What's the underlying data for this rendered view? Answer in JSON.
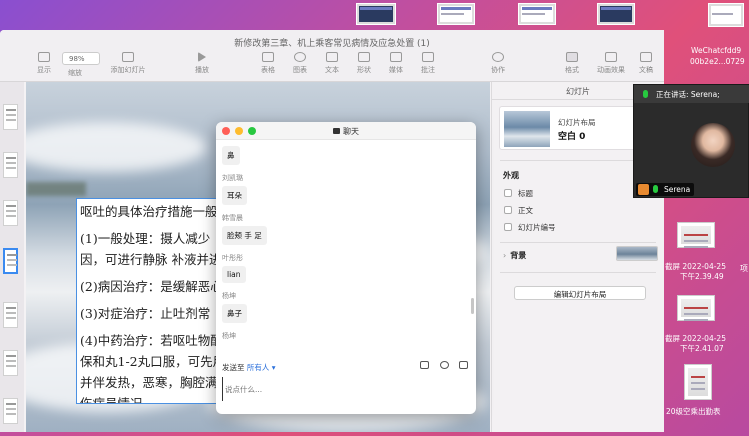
{
  "keynote": {
    "window_title": "新修改第三章、机上乘客常见病情及应急处置 (1)",
    "toolbar": {
      "view_label": "显示",
      "zoom_value": "98%",
      "zoom_label": "缩放",
      "add_slide_label": "添加幻灯片",
      "play_label": "播放",
      "table_label": "表格",
      "chart_label": "图表",
      "text_label": "文本",
      "shape_label": "形状",
      "media_label": "媒体",
      "comment_label": "批注",
      "collaborate_label": "协作",
      "format_label": "格式",
      "animate_label": "动画效果",
      "document_label": "文稿"
    },
    "slide_text": [
      "呕吐的具体治疗措施一般",
      "(1)一般处理：摄人减少",
      "因，可进行静脉 补液并进",
      "(2)病因治疗：是缓解恶心",
      "(3)对症治疗：止吐剂常",
      "(4)中药治疗：若呕吐物酸",
      "保和丸1-2丸口服，可先用",
      "并伴发热，恶寒，胸腔满",
      "伤病员情况。"
    ],
    "inspector": {
      "header": "幻灯片",
      "layout_label": "幻灯片布局",
      "layout_value": "空白 0",
      "appearance_title": "外观",
      "checkbox_title": "标题",
      "checkbox_body": "正文",
      "checkbox_slide_number": "幻灯片编号",
      "background_label": "背景",
      "edit_layout_button": "编辑幻灯片布局"
    }
  },
  "chat": {
    "title": "聊天",
    "messages": [
      {
        "sender": "",
        "text": "鼻"
      },
      {
        "sender": "刘凯璐",
        "text": "耳朵"
      },
      {
        "sender": "韩雪晨",
        "text": "脸颊 手 足"
      },
      {
        "sender": "叶彤彤",
        "text": "lian"
      },
      {
        "sender": "杨坤",
        "text": "鼻子"
      },
      {
        "sender": "杨坤",
        "text": ""
      }
    ],
    "send_to_label": "发送至",
    "send_to_value": "所有人",
    "input_placeholder": "说点什么..."
  },
  "video": {
    "speaking_label": "正在讲话: Serena;",
    "participant_name": "Serena"
  },
  "desktop": {
    "file1_label": "WeChatcfdd9",
    "file1_label2": "00b2e2...0729",
    "screenshot1_label": "截屏 2022-04-25",
    "screenshot1_time": "下午2.39.49",
    "screenshot2_label": "截屏 2022-04-25",
    "screenshot2_time": "下午2.41.07",
    "doc_label": "20级空乘出勤表",
    "edge_char": "项"
  },
  "colors": {
    "accent_blue": "#2a6fdb",
    "selection_blue": "#4a90e2",
    "mic_green": "#27c93f",
    "traffic_red": "#ff5f57",
    "traffic_yellow": "#febc2e",
    "traffic_green": "#28c840"
  }
}
